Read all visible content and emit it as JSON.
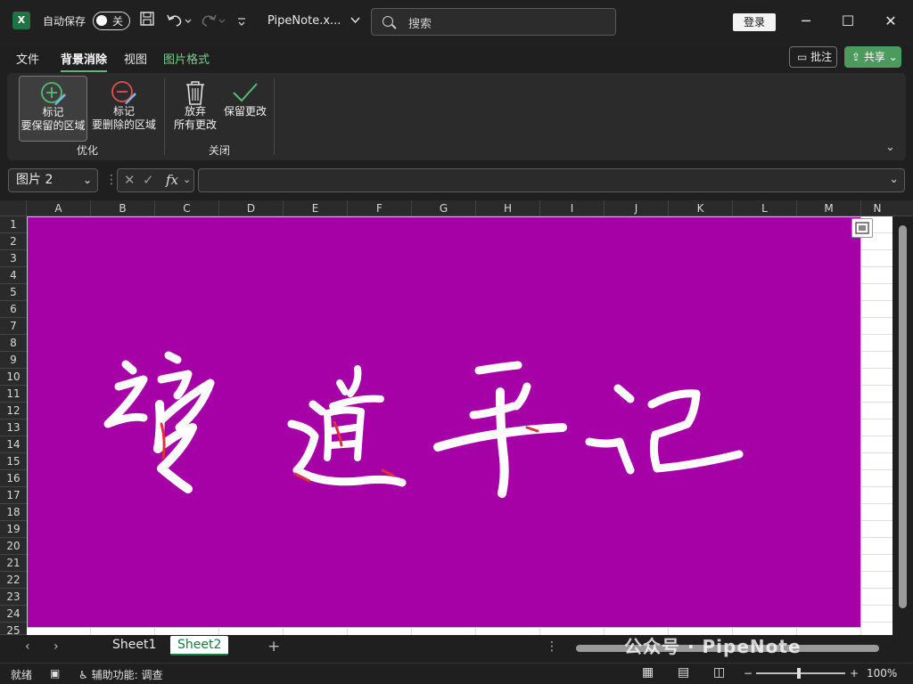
{
  "titlebar": {
    "app_badge": "X",
    "autosave_label": "自动保存",
    "autosave_state": "关",
    "filename": "PipeNote.x...",
    "search_placeholder": "搜索",
    "login_label": "登录",
    "minimize_glyph": "─",
    "maximize_glyph": "☐",
    "close_glyph": "✕"
  },
  "menu": {
    "items": [
      "文件",
      "背景消除",
      "视图",
      "图片格式"
    ],
    "comment_label": "批注",
    "share_label": "共享"
  },
  "ribbon": {
    "mark_keep_line1": "标记",
    "mark_keep_line2": "要保留的区域",
    "mark_remove_line1": "标记",
    "mark_remove_line2": "要删除的区域",
    "group_refine": "优化",
    "discard_line1": "放弃",
    "discard_line2": "所有更改",
    "keep_changes_label": "保留更改",
    "group_close": "关闭"
  },
  "formula_bar": {
    "name_box": "图片 2",
    "fx_label": "fx",
    "formula": ""
  },
  "grid": {
    "columns": [
      "A",
      "B",
      "C",
      "D",
      "E",
      "F",
      "G",
      "H",
      "I",
      "J",
      "K",
      "L",
      "M",
      "N"
    ],
    "rows": [
      "1",
      "2",
      "3",
      "4",
      "5",
      "6",
      "7",
      "8",
      "9",
      "10",
      "11",
      "12",
      "13",
      "14",
      "15",
      "16",
      "17",
      "18",
      "19",
      "20",
      "21",
      "22",
      "23",
      "24",
      "25"
    ]
  },
  "picture": {
    "background_color": "#a600a7",
    "stroke_color": "#ffffff",
    "marked_removal_color": "#e0303a"
  },
  "tabs": {
    "sheets": [
      "Sheet1",
      "Sheet2"
    ],
    "active": "Sheet2",
    "add_glyph": "+"
  },
  "statusbar": {
    "ready": "就绪",
    "accessibility": "辅助功能: 调查",
    "zoom_minus": "−",
    "zoom_plus": "+",
    "zoom": "100%"
  },
  "watermark": "公众号 · PipeNote"
}
